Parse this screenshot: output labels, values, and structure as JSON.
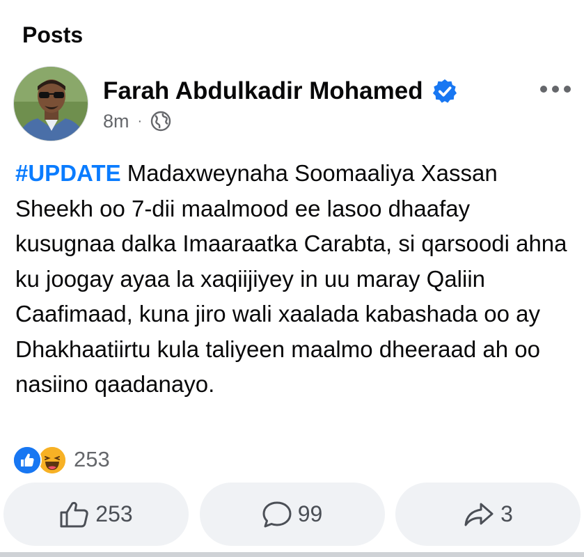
{
  "section": {
    "title": "Posts"
  },
  "post": {
    "author": "Farah Abdulkadir Mohamed",
    "verified": true,
    "time": "8m",
    "separator": "·",
    "audience_icon": "globe-icon",
    "hashtag": "#UPDATE",
    "body": "Madaxweynaha Soomaaliya Xassan Sheekh oo 7-dii maalmood ee lasoo dhaafay kusugnaa dalka Imaaraatka Carabta, si qarsoodi ahna ku joogay ayaa la xaqiijiyey in uu maray Qaliin Caafimaad, kuna jiro wali xaalada kabashada oo ay Dhakhaatiirtu kula taliyeen maalmo dheeraad ah oo nasiino qaadanayo.",
    "reactions": {
      "types": [
        "like",
        "haha"
      ],
      "count": "253"
    },
    "actions": {
      "like": {
        "icon": "thumbs-up-icon",
        "count": "253"
      },
      "comment": {
        "icon": "comment-bubble-icon",
        "count": "99"
      },
      "share": {
        "icon": "share-arrow-icon",
        "count": "3"
      }
    }
  },
  "colors": {
    "hashtag": "#0a7cff",
    "verified_badge": "#1877f2",
    "secondary_text": "#65676b",
    "button_bg": "#f0f2f5",
    "like_reaction": "#1877f2",
    "haha_reaction": "#f7b125"
  }
}
